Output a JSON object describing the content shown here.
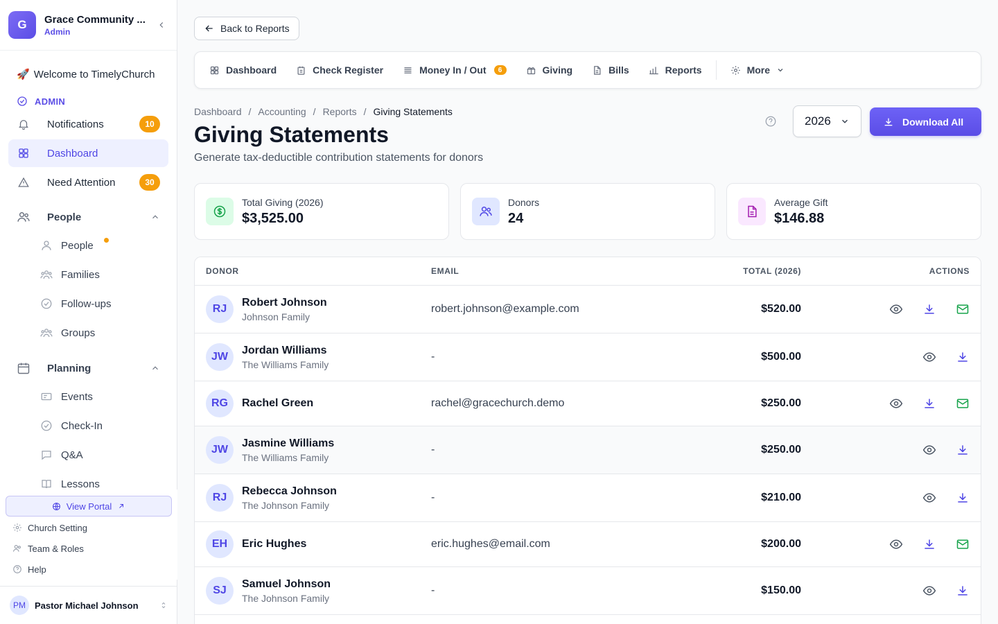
{
  "org": {
    "initial": "G",
    "name": "Grace Community ...",
    "role": "Admin"
  },
  "sidebar": {
    "welcome": "Welcome to TimelyChurch",
    "welcome_emoji": "🚀",
    "admin_label": "ADMIN",
    "items": [
      {
        "label": "Notifications",
        "badge": "10"
      },
      {
        "label": "Dashboard"
      },
      {
        "label": "Need Attention",
        "badge": "30"
      }
    ],
    "people_section": "People",
    "people_items": [
      "People",
      "Families",
      "Follow-ups",
      "Groups"
    ],
    "planning_section": "Planning",
    "planning_items": [
      "Events",
      "Check-In",
      "Q&A",
      "Lessons"
    ],
    "view_portal": "View Portal",
    "links": [
      "Church Setting",
      "Team & Roles",
      "Help"
    ],
    "user": {
      "initials": "PM",
      "name": "Pastor Michael Johnson"
    }
  },
  "back_button": "Back to Reports",
  "tabs": [
    {
      "label": "Dashboard"
    },
    {
      "label": "Check Register"
    },
    {
      "label": "Money In / Out",
      "badge": "6"
    },
    {
      "label": "Giving"
    },
    {
      "label": "Bills"
    },
    {
      "label": "Reports"
    },
    {
      "label": "More"
    }
  ],
  "breadcrumb": [
    "Dashboard",
    "Accounting",
    "Reports",
    "Giving Statements"
  ],
  "breadcrumb_sep": "/",
  "page": {
    "title": "Giving Statements",
    "subtitle": "Generate tax-deductible contribution statements for donors",
    "year": "2026",
    "download_all": "Download All"
  },
  "stats": [
    {
      "label": "Total Giving (2026)",
      "value": "$3,525.00",
      "color": "#16a34a",
      "bg": "#dcfce7"
    },
    {
      "label": "Donors",
      "value": "24",
      "color": "#4f46e5",
      "bg": "#e0e7ff"
    },
    {
      "label": "Average Gift",
      "value": "$146.88",
      "color": "#a21caf",
      "bg": "#fae8ff"
    }
  ],
  "table": {
    "headers": {
      "donor": "DONOR",
      "email": "EMAIL",
      "total": "TOTAL (2026)",
      "actions": "ACTIONS"
    },
    "rows": [
      {
        "initials": "RJ",
        "name": "Robert Johnson",
        "family": "Johnson Family",
        "email": "robert.johnson@example.com",
        "total": "$520.00",
        "has_email": true
      },
      {
        "initials": "JW",
        "name": "Jordan Williams",
        "family": "The Williams Family",
        "email": "-",
        "total": "$500.00",
        "has_email": false
      },
      {
        "initials": "RG",
        "name": "Rachel Green",
        "family": "",
        "email": "rachel@gracechurch.demo",
        "total": "$250.00",
        "has_email": true
      },
      {
        "initials": "JW",
        "name": "Jasmine Williams",
        "family": "The Williams Family",
        "email": "-",
        "total": "$250.00",
        "has_email": false
      },
      {
        "initials": "RJ",
        "name": "Rebecca Johnson",
        "family": "The Johnson Family",
        "email": "-",
        "total": "$210.00",
        "has_email": false
      },
      {
        "initials": "EH",
        "name": "Eric Hughes",
        "family": "",
        "email": "eric.hughes@email.com",
        "total": "$200.00",
        "has_email": true
      },
      {
        "initials": "SJ",
        "name": "Samuel Johnson",
        "family": "The Johnson Family",
        "email": "-",
        "total": "$150.00",
        "has_email": false
      }
    ]
  },
  "colors": {
    "accent": "#4f46e5",
    "warning": "#f59e0b",
    "success": "#16a34a"
  }
}
